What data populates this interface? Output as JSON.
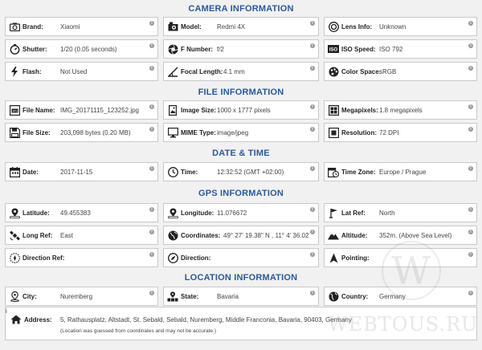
{
  "sections": {
    "camera": "CAMERA INFORMATION",
    "file": "FILE INFORMATION",
    "datetime": "DATE & TIME",
    "gps": "GPS INFORMATION",
    "location": "LOCATION INFORMATION"
  },
  "camera": {
    "brand": {
      "label": "Brand:",
      "value": "Xiaomi"
    },
    "model": {
      "label": "Model:",
      "value": "Redmi 4X"
    },
    "lens": {
      "label": "Lens Info:",
      "value": "Unknown"
    },
    "shutter": {
      "label": "Shutter:",
      "value": "1/20 (0.05 seconds)"
    },
    "fnumber": {
      "label": "F Number:",
      "value": "f/2"
    },
    "iso": {
      "label": "ISO Speed:",
      "value": "ISO 792"
    },
    "flash": {
      "label": "Flash:",
      "value": "Not Used"
    },
    "focal": {
      "label": "Focal Length:",
      "value": "4.1 mm"
    },
    "colorspace": {
      "label": "Color Space:",
      "value": "sRGB"
    }
  },
  "file": {
    "name": {
      "label": "File Name:",
      "value": "IMG_20171115_123252.jpg"
    },
    "imagesize": {
      "label": "Image Size:",
      "value": "1000 x 1777 pixels"
    },
    "megapixels": {
      "label": "Megapixels:",
      "value": "1.8 megapixels"
    },
    "filesize": {
      "label": "File Size:",
      "value": "203,098 bytes (0.20 MB)"
    },
    "mime": {
      "label": "MIME Type:",
      "value": "image/jpeg"
    },
    "resolution": {
      "label": "Resolution:",
      "value": "72 DPI"
    }
  },
  "datetime": {
    "date": {
      "label": "Date:",
      "value": "2017-11-15"
    },
    "time": {
      "label": "Time:",
      "value": "12:32:52 (GMT +02:00)"
    },
    "timezone": {
      "label": "Time Zone:",
      "value": "Europe / Prague"
    }
  },
  "gps": {
    "latitude": {
      "label": "Latitude:",
      "value": "49.455383"
    },
    "longitude": {
      "label": "Longitude:",
      "value": "11.076672"
    },
    "latref": {
      "label": "Lat Ref:",
      "value": "North"
    },
    "longref": {
      "label": "Long Ref:",
      "value": "East"
    },
    "coordinates": {
      "label": "Coordinates:",
      "value": "49° 27' 19.38\" N , 11° 4' 36.02\" E"
    },
    "altitude": {
      "label": "Altitude:",
      "value": "352m. (Above Sea Level)"
    },
    "directionref": {
      "label": "Direction Ref:",
      "value": ""
    },
    "direction": {
      "label": "Direction:",
      "value": ""
    },
    "pointing": {
      "label": "Pointing:",
      "value": ""
    }
  },
  "location": {
    "city": {
      "label": "City:",
      "value": "Nuremberg"
    },
    "state": {
      "label": "State:",
      "value": "Bavaria"
    },
    "country": {
      "label": "Country:",
      "value": "Germany"
    },
    "address": {
      "label": "Address:",
      "value": "5, Rathausplatz, Altstadt, St. Sebald, Sebald, Nuremberg, Middle Franconia, Bavaria, 90403, Germany",
      "note": "(Location was guessed from coordinates and may not be accurate.)"
    }
  },
  "info_glyph": "i",
  "watermark": {
    "text": "WEBTOUS.RU",
    "logo": "W"
  }
}
